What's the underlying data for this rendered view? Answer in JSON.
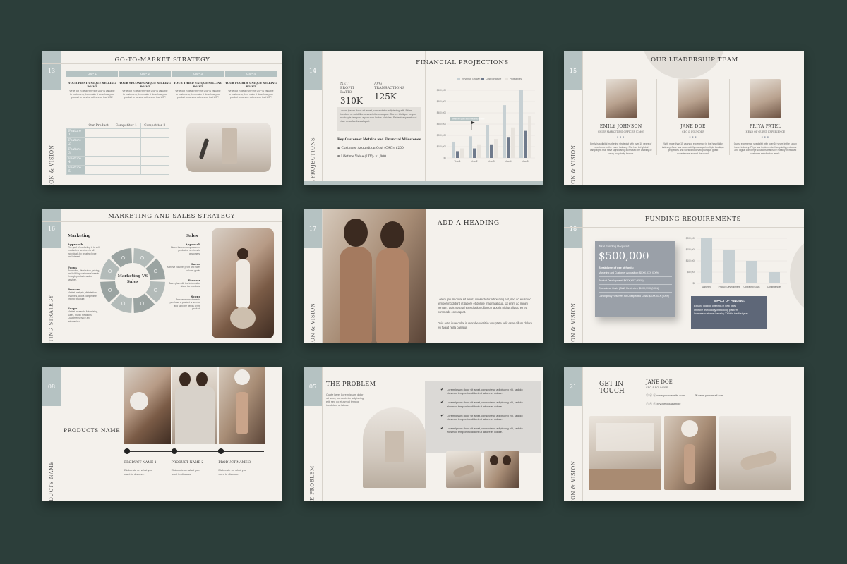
{
  "s1": {
    "num": "13",
    "title": "GO-TO-MARKET STRATEGY",
    "side": "MISION & VISION",
    "usps": [
      {
        "head": "USP 1",
        "label": "Your first unique selling point",
        "desc": "Write out in detail why this USP is valuable to customers, then make it clear how your product or service delivers on that USP."
      },
      {
        "head": "USP 2",
        "label": "Your second unique selling point",
        "desc": "Write out in detail why this USP is valuable to customers, then make it clear how your product or service delivers on that USP."
      },
      {
        "head": "USP 3",
        "label": "Your third unique selling point",
        "desc": "Write out in detail why this USP is valuable to customers, then make it clear how your product or service delivers on that USP."
      },
      {
        "head": "USP 4",
        "label": "Your fourth unique selling point",
        "desc": "Write out in detail why this USP is valuable to customers, then make it clear how your product or service delivers on that USP."
      }
    ],
    "cols": [
      "Our Product",
      "Competitor 1",
      "Competitor 2"
    ],
    "features": [
      "Feature 1",
      "Feature 2",
      "Feature 3",
      "Feature 4",
      "Feature 5"
    ]
  },
  "s2": {
    "num": "14",
    "title": "FINANCIAL PROJECTIONS",
    "side": "FINANCIAL PROJECTIONS",
    "m1_label": "Net Profit Ratio",
    "m1_value": "310K",
    "m2_label": "Avg Transactions",
    "m2_value": "125K",
    "para": "Lorem ipsum dolor sit amet, consectetur adipiscing elit. Etiam tincidunt urna id libero suscipit consequat. Donec tristique neque nec turpis tempus, a posuere lectus ultricies. Pellentesque et orci vitae urna facilisis aliquet.",
    "kcm": "Key Customer Metrics and Financial Milestones",
    "cac": "Customer Acquisition Cost (CAC): $200",
    "ltv": "Lifetime Value (LTV): $1,000",
    "legend": [
      "Revenue Growth",
      "Cost Structure",
      "Profitability"
    ],
    "yticks": [
      "$0",
      "$100,000",
      "$200,000",
      "$300,000",
      "$400,000",
      "$500,000",
      "$600,000"
    ],
    "xcats": [
      "Year 1",
      "Year 2",
      "Year 3",
      "Year 4",
      "Year 5"
    ],
    "marker": "Breakeven point and profitability timeline"
  },
  "s3": {
    "num": "15",
    "title": "OUR LEADERSHIP TEAM",
    "side": "MISION & VISION",
    "people": [
      {
        "name": "EMILY JOHNSON",
        "role": "Chief Marketing Officer (CMO)",
        "bio": "Emily is a digital marketing strategist with over 10 years of experience in the travel industry. She has led global campaigns that have significantly increased the visibility of luxury hospitality brands."
      },
      {
        "name": "JANE DOE",
        "role": "CEO & Founder",
        "bio": "With more than 15 years of experience in the hospitality industry, Jane has successfully managed multiple boutique properties and worked to develop unique guest experiences around the world."
      },
      {
        "name": "PRIYA PATEL",
        "role": "Head of Guest Experience",
        "bio": "Guest experience specialist with over 10 years in the luxury travel industry. Priya has implemented hospitality protocols and digital concierge solutions that have notably increased customer satisfaction levels."
      }
    ]
  },
  "s4": {
    "num": "16",
    "title": "MARKETING AND SALES STRATEGY",
    "side": "MARKETING STRATEGY",
    "left_head": "Marketing",
    "right_head": "Sales",
    "center": "Marketing VS Sales",
    "left_items": [
      {
        "label": "Approach",
        "desc": "The goal of marketing is to sell products or services to all individuals by creating hype and interest."
      },
      {
        "label": "Focus",
        "desc": "Promotion, distribution, pricing, and fulfilling customers' needs through products and/or services."
      },
      {
        "label": "Process",
        "desc": "Market analysis, distribution channels, and a competitive pricing structure."
      },
      {
        "label": "Scope",
        "desc": "Market research, Advertising, Sales, Public Relations, Customer service and satisfaction."
      }
    ],
    "right_items": [
      {
        "label": "Approach",
        "desc": "Match the company's current product or services to customers."
      },
      {
        "label": "Focus",
        "desc": "Achieve volume, profit and sales volume goals."
      },
      {
        "label": "Process",
        "desc": "Sales plan with the information about the products."
      },
      {
        "label": "Scope",
        "desc": "Persuade a customer to purchase a product or service and fulfill the needs of the product."
      }
    ]
  },
  "s5": {
    "num": "17",
    "title": "ADD A HEADING",
    "side": "MISION & VISION",
    "p1": "Lorem ipsum dolor sit amet, consectetur adipiscing elit, sed do eiusmod tempor incididunt ut labore et dolore magna aliqua. Ut enim ad minim veniam, quis nostrud exercitation ullamco laboris nisi ut aliquip ex ea commodo consequat.",
    "p2": "Duis aute irure dolor in reprehenderit in voluptate velit esse cillum dolore eu fugiat nulla pariatur."
  },
  "s6": {
    "num": "18",
    "title": "FUNDING REQUIREMENTS",
    "side": "MISION & VISION",
    "total_label": "Total Funding Required",
    "total": "$500,000",
    "breakdown_head": "Breakdown of use of funds:",
    "lines": [
      "Marketing and Customer Acquisition: $XXX,XXX (XX%)",
      "Product Development: $XXX,XXX (XX%)",
      "Operational Costs (Staff, Rent, etc.): $XXX,XXX (XX%)",
      "Contingency Reserves for Unexpected Costs: $XXX,XXX (XX%)"
    ],
    "impact_head": "IMPACT OF FUNDING:",
    "impacts": [
      "Expand lodging offerings in new cities",
      "Improve technology in booking platform",
      "Increase customer base by XX% in the first year"
    ],
    "yticks": [
      "$0",
      "$50,000",
      "$100,000",
      "$150,000",
      "$200,000"
    ],
    "cats": [
      "Marketing",
      "Product Development",
      "Operating Costs",
      "Contingencies"
    ],
    "chart_data": {
      "type": "bar",
      "categories": [
        "Marketing",
        "Product Development",
        "Operating Costs",
        "Contingencies"
      ],
      "values": [
        200000,
        150000,
        100000,
        50000
      ],
      "ylim": [
        0,
        200000
      ]
    }
  },
  "s7": {
    "num": "08",
    "side": "PRODUCTS NAME",
    "heading": "PRODUCTS NAME",
    "products": [
      {
        "name": "Product Name 1",
        "desc": "Elaborate on what you want to discuss."
      },
      {
        "name": "Product Name 2",
        "desc": "Elaborate on what you want to discuss."
      },
      {
        "name": "Product Name 3",
        "desc": "Elaborate on what you want to discuss."
      }
    ]
  },
  "s8": {
    "num": "05",
    "side": "THE PROBLEM",
    "title": "THE PROBLEM",
    "quote": "Quote here. Lorem ipsum dolor sit amet, consectetur adipiscing elit, sed do eiusmod tempor incididunt ut labore.",
    "checks": [
      "Lorem ipsum dolor sit amet, consectetur adipiscing elit, sed do eiusmod tempor incididunt ut labore et dolore.",
      "Lorem ipsum dolor sit amet, consectetur adipiscing elit, sed do eiusmod tempor incididunt ut labore et dolore.",
      "Lorem ipsum dolor sit amet, consectetur adipiscing elit, sed do eiusmod tempor incididunt ut labore et dolore.",
      "Lorem ipsum dolor sit amet, consectetur adipiscing elit, sed do eiusmod tempor incididunt ut labore et dolore."
    ]
  },
  "s9": {
    "num": "21",
    "side": "MISION & VISION",
    "title1": "GET IN",
    "title2": "TOUCH",
    "name": "JANE DOE",
    "role": "CEO & FOUNDER",
    "website": "www.yourwebsite.com",
    "email": "www.youremail.com",
    "social": "@yoursocialhandle"
  },
  "colors": {
    "background": "#2c3e3a",
    "slide": "#f4f1ec",
    "accent": "#b5c2c2",
    "slate": "#7f8c96",
    "dark": "#5e6778"
  }
}
